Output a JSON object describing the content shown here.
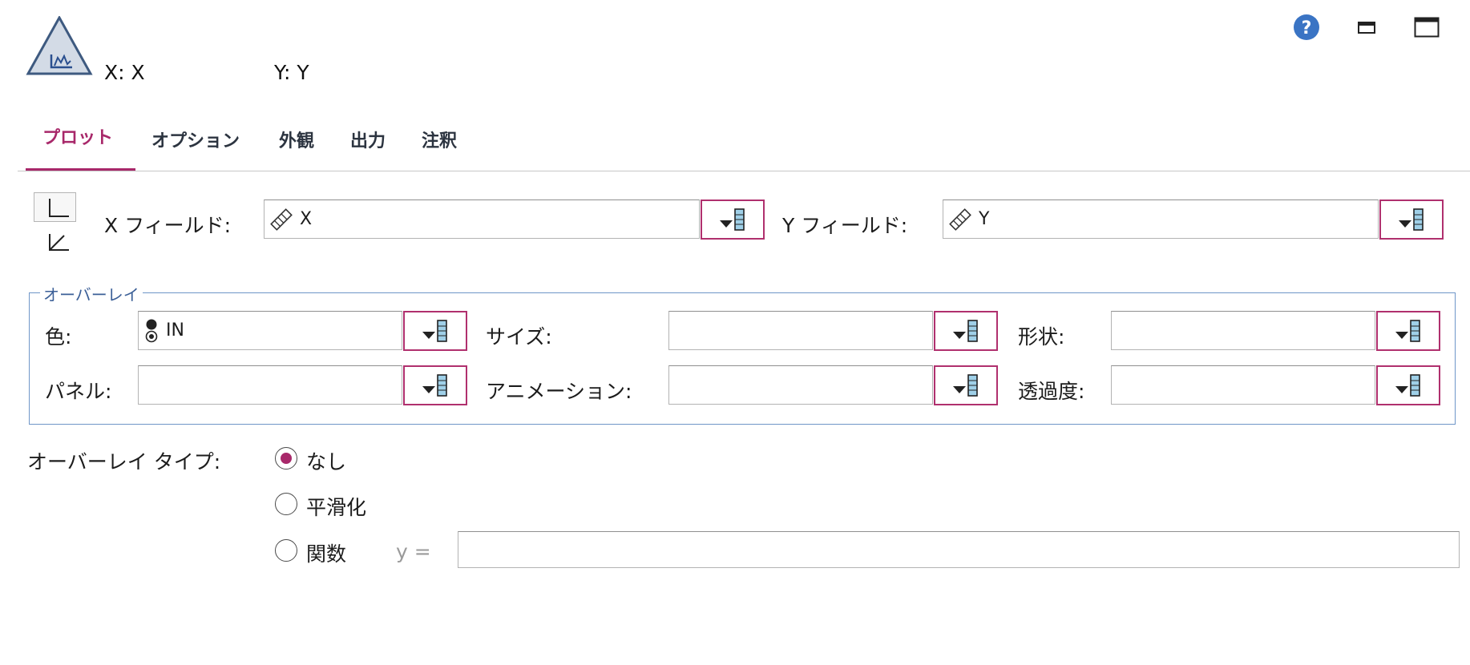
{
  "header": {
    "x_label": "X: X",
    "y_label": "Y: Y",
    "help_icon": "help-icon",
    "minimize_icon": "minimize-icon",
    "maximize_icon": "maximize-icon"
  },
  "tabs": [
    {
      "label": "プロット",
      "active": true
    },
    {
      "label": "オプション",
      "active": false
    },
    {
      "label": "外観",
      "active": false
    },
    {
      "label": "出力",
      "active": false
    },
    {
      "label": "注釈",
      "active": false
    }
  ],
  "plot": {
    "x_field_label": "X フィールド:",
    "x_field_value": "X",
    "y_field_label": "Y フィールド:",
    "y_field_value": "Y"
  },
  "overlay": {
    "title": "オーバーレイ",
    "color_label": "色:",
    "color_value": "IN",
    "size_label": "サイズ:",
    "size_value": "",
    "shape_label": "形状:",
    "shape_value": "",
    "panel_label": "パネル:",
    "panel_value": "",
    "animation_label": "アニメーション:",
    "animation_value": "",
    "transparency_label": "透過度:",
    "transparency_value": ""
  },
  "overlay_type": {
    "label": "オーバーレイ タイプ:",
    "options": [
      "なし",
      "平滑化",
      "関数"
    ],
    "selected": "なし",
    "function_prefix": "y =",
    "function_value": ""
  },
  "colors": {
    "accent": "#a8286a",
    "group_border": "#6f96c8",
    "group_title": "#3b5f97"
  }
}
